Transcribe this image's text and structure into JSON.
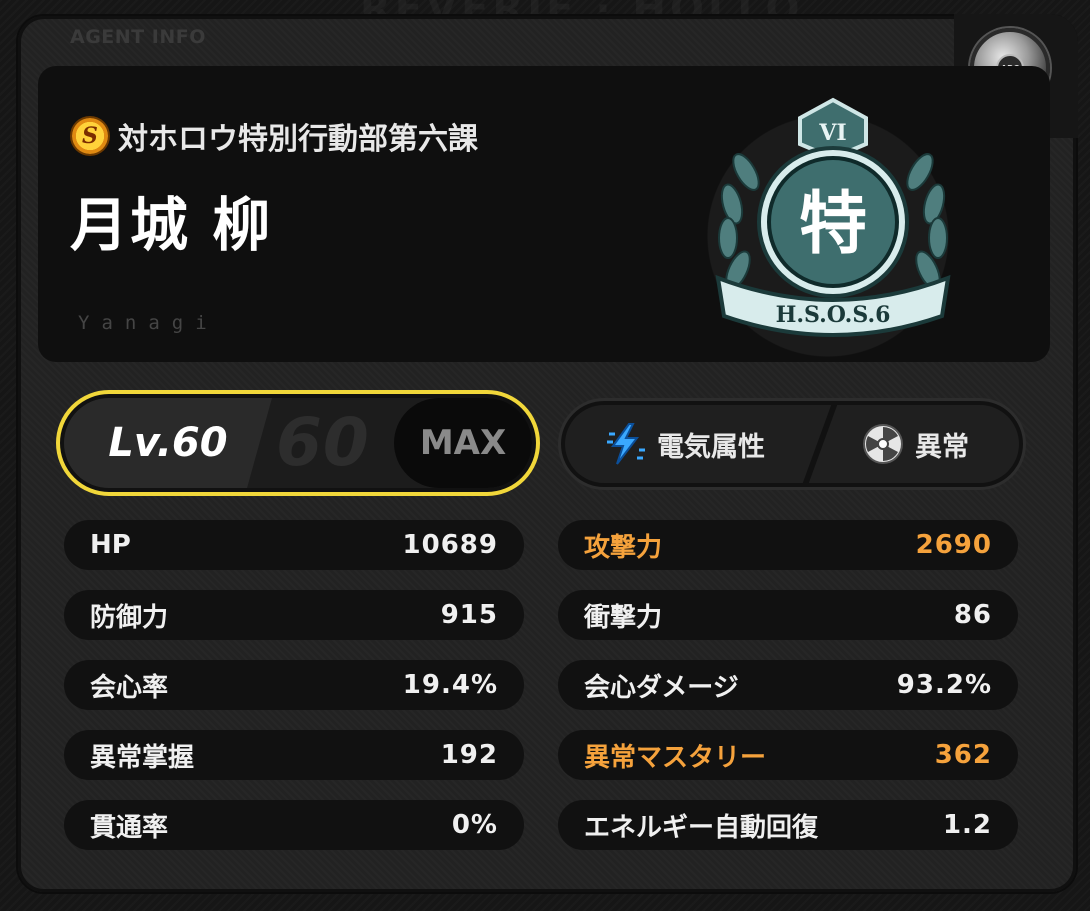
{
  "panel": {
    "title": "AGENT INFO"
  },
  "corner_disc": {
    "icon": "disc-icon",
    "hub_text": "ABC"
  },
  "agent": {
    "rank": "S",
    "faction": "対ホロウ特別行動部第六課",
    "name": "月城  柳",
    "name_roman": "Yanagi",
    "emblem": {
      "icon": "hsos6-emblem",
      "top_text": "VI",
      "center_text": "特",
      "ribbon_text": "H.S.O.S.6"
    }
  },
  "level": {
    "label": "Lv.60",
    "max_level": "60",
    "max_label": "MAX"
  },
  "attributes": {
    "element": {
      "label": "電気属性",
      "icon": "electric-icon"
    },
    "specialty": {
      "label": "異常",
      "icon": "anomaly-icon"
    }
  },
  "stats_left": [
    {
      "label": "HP",
      "value": "10689",
      "highlight": false
    },
    {
      "label": "防御力",
      "value": "915",
      "highlight": false
    },
    {
      "label": "会心率",
      "value": "19.4%",
      "highlight": false
    },
    {
      "label": "異常掌握",
      "value": "192",
      "highlight": false
    },
    {
      "label": "貫通率",
      "value": "0%",
      "highlight": false
    }
  ],
  "stats_right": [
    {
      "label": "攻撃力",
      "value": "2690",
      "highlight": true
    },
    {
      "label": "衝撃力",
      "value": "86",
      "highlight": false
    },
    {
      "label": "会心ダメージ",
      "value": "93.2%",
      "highlight": false
    },
    {
      "label": "異常マスタリー",
      "value": "362",
      "highlight": true
    },
    {
      "label": "エネルギー自動回復",
      "value": "1.2",
      "highlight": false
    }
  ],
  "colors": {
    "accent_yellow": "#f1d73a",
    "highlight_orange": "#f5a23c",
    "electric_blue": "#3aa8ff"
  }
}
